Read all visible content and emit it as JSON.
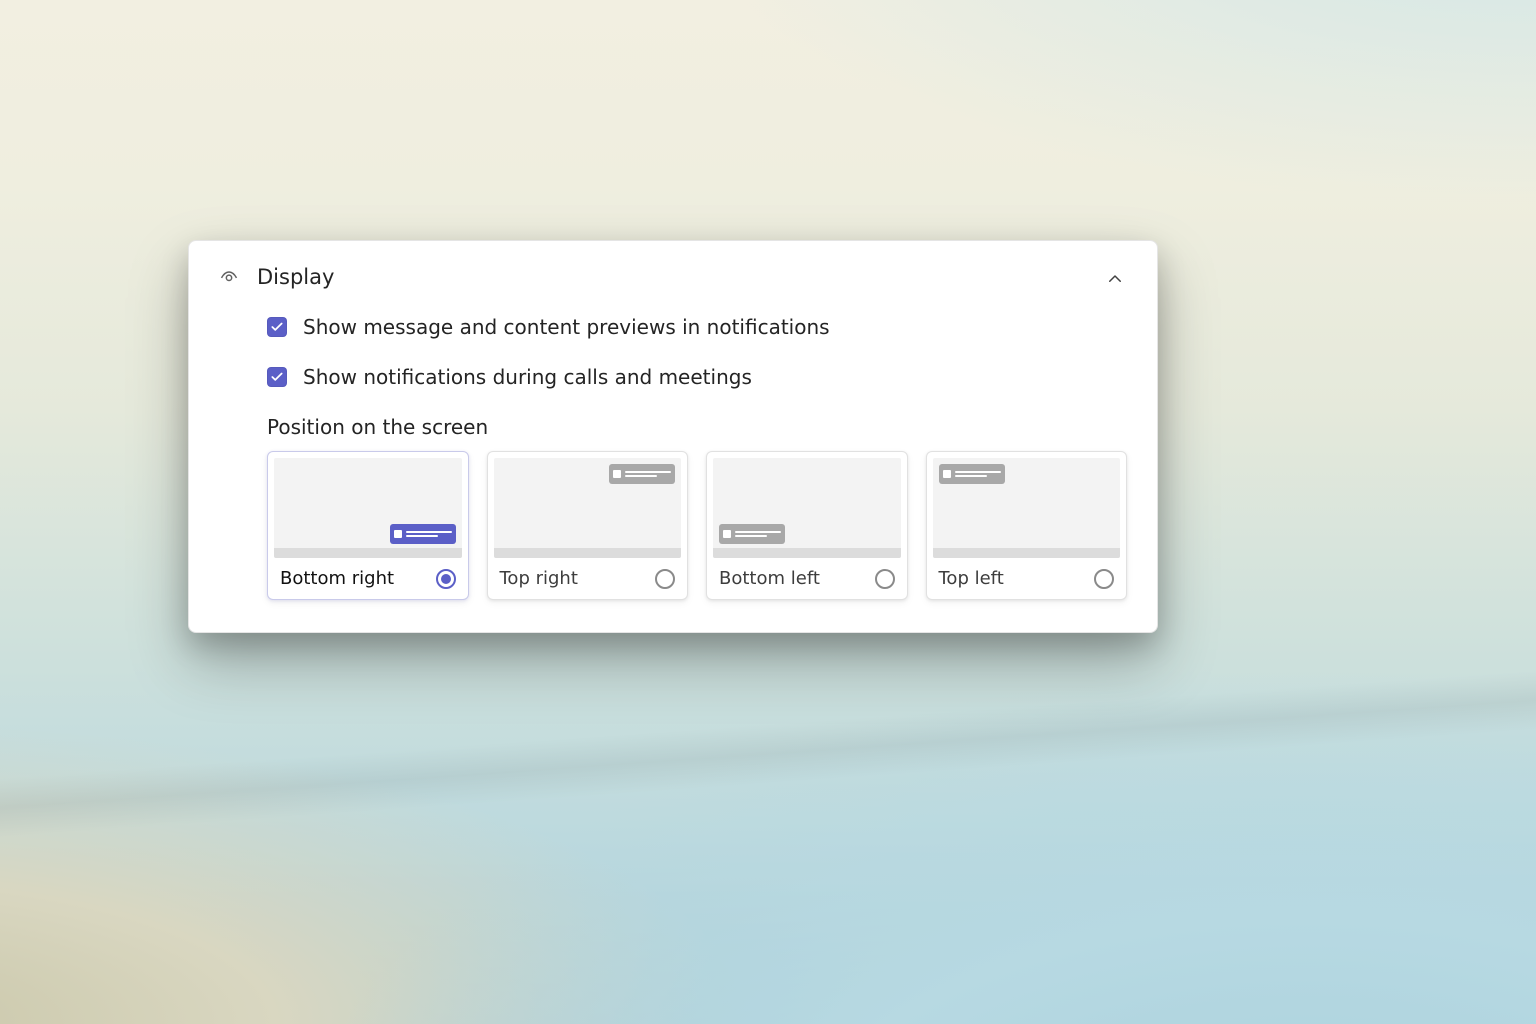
{
  "section": {
    "title": "Display",
    "expanded": true,
    "checkboxes": [
      {
        "id": "previews",
        "label": "Show message and content previews in notifications",
        "checked": true
      },
      {
        "id": "during_calls",
        "label": "Show notifications during calls and meetings",
        "checked": true
      }
    ],
    "position": {
      "label": "Position on the screen",
      "selected": "bottom_right",
      "options": [
        {
          "id": "bottom_right",
          "label": "Bottom right"
        },
        {
          "id": "top_right",
          "label": "Top right"
        },
        {
          "id": "bottom_left",
          "label": "Bottom left"
        },
        {
          "id": "top_left",
          "label": "Top left"
        }
      ]
    }
  },
  "colors": {
    "accent": "#5b5fc7"
  }
}
